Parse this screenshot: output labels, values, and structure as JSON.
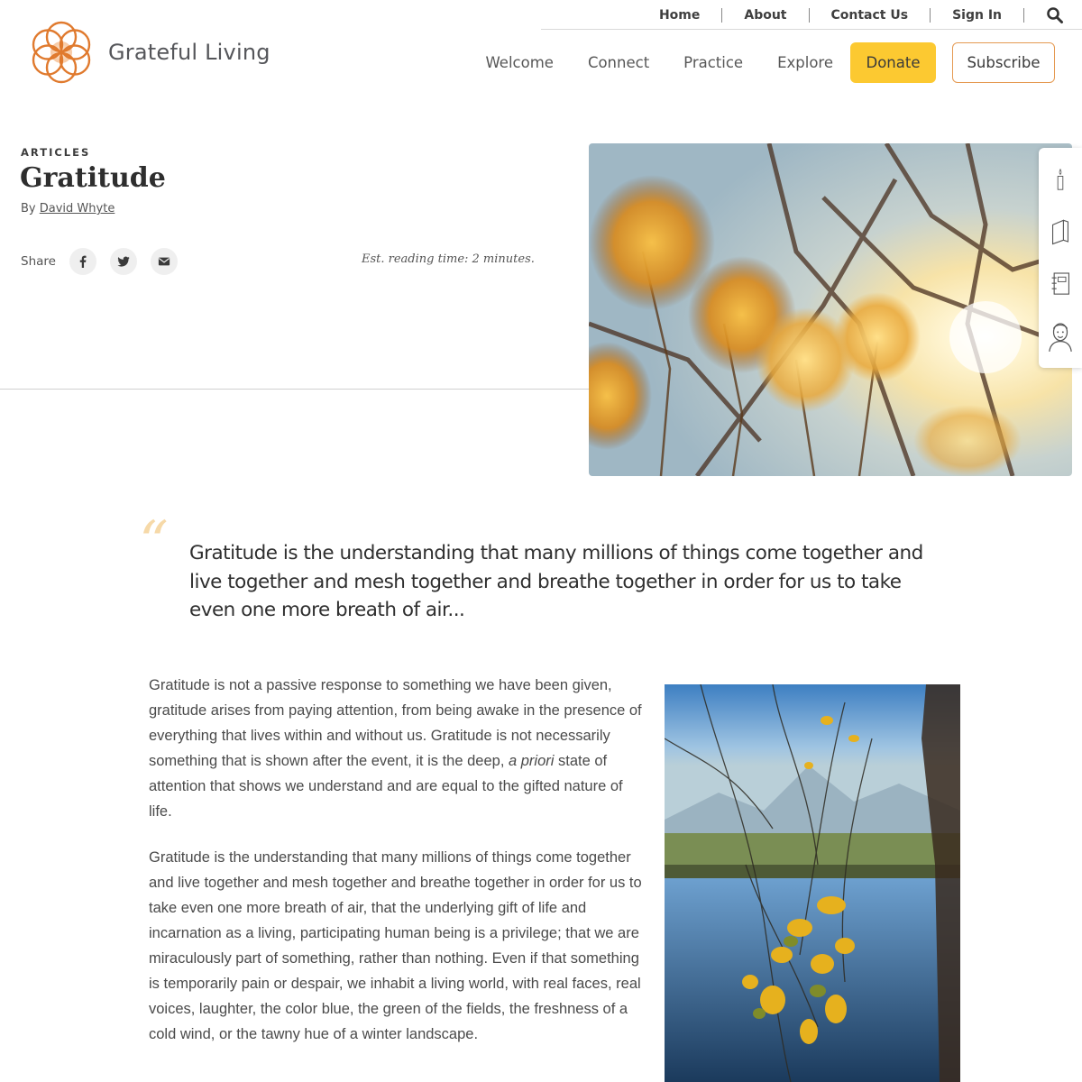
{
  "brand": {
    "name": "Grateful Living"
  },
  "utility_nav": {
    "items": [
      {
        "label": "Home"
      },
      {
        "label": "About"
      },
      {
        "label": "Contact Us"
      },
      {
        "label": "Sign In"
      }
    ],
    "search_icon": "search-icon"
  },
  "main_nav": {
    "items": [
      {
        "label": "Welcome"
      },
      {
        "label": "Connect"
      },
      {
        "label": "Practice"
      },
      {
        "label": "Explore"
      }
    ],
    "donate_label": "Donate",
    "subscribe_label": "Subscribe"
  },
  "colors": {
    "accent_orange": "#e07a2e",
    "donate_yellow": "#fcc931",
    "quote_mark": "#f6d9a8"
  },
  "article": {
    "kicker": "ARTICLES",
    "title": "Gratitude",
    "by_prefix": "By",
    "author": "David Whyte",
    "share_label": "Share",
    "share_icons": [
      "facebook-icon",
      "twitter-icon",
      "email-icon"
    ],
    "reading_time": "Est. reading time: 2 minutes.",
    "pull_quote": "Gratitude is the understanding that many millions of things come together and live together and mesh together and breathe together in order for us to take even one more breath of air...",
    "paragraph1_a": "Gratitude is not a passive response to something we have been given, gratitude arises from paying attention, from being awake in the presence of everything that lives within and without us. Gratitude is not necessarily something that is shown after the event, it is the deep, ",
    "paragraph1_em": "a priori",
    "paragraph1_b": " state of attention that shows we understand and are equal to the gifted nature of life.",
    "paragraph2": "Gratitude is the understanding that many millions of things come together and live together and mesh together and breathe together in order for us to take even one more breath of air, that the underlying gift of life and incarnation as a living, participating human being is a privilege; that we are miraculously part of something, rather than nothing. Even if that something is temporarily pain or despair, we inhabit a living world, with real faces, real voices, laughter, the color blue, the green of the fields, the freshness of a cold wind, or the tawny hue of a winter landscape."
  },
  "side_toolbar": {
    "icons": [
      "candle-icon",
      "journal-icon",
      "notebook-icon",
      "person-portrait-icon"
    ]
  }
}
